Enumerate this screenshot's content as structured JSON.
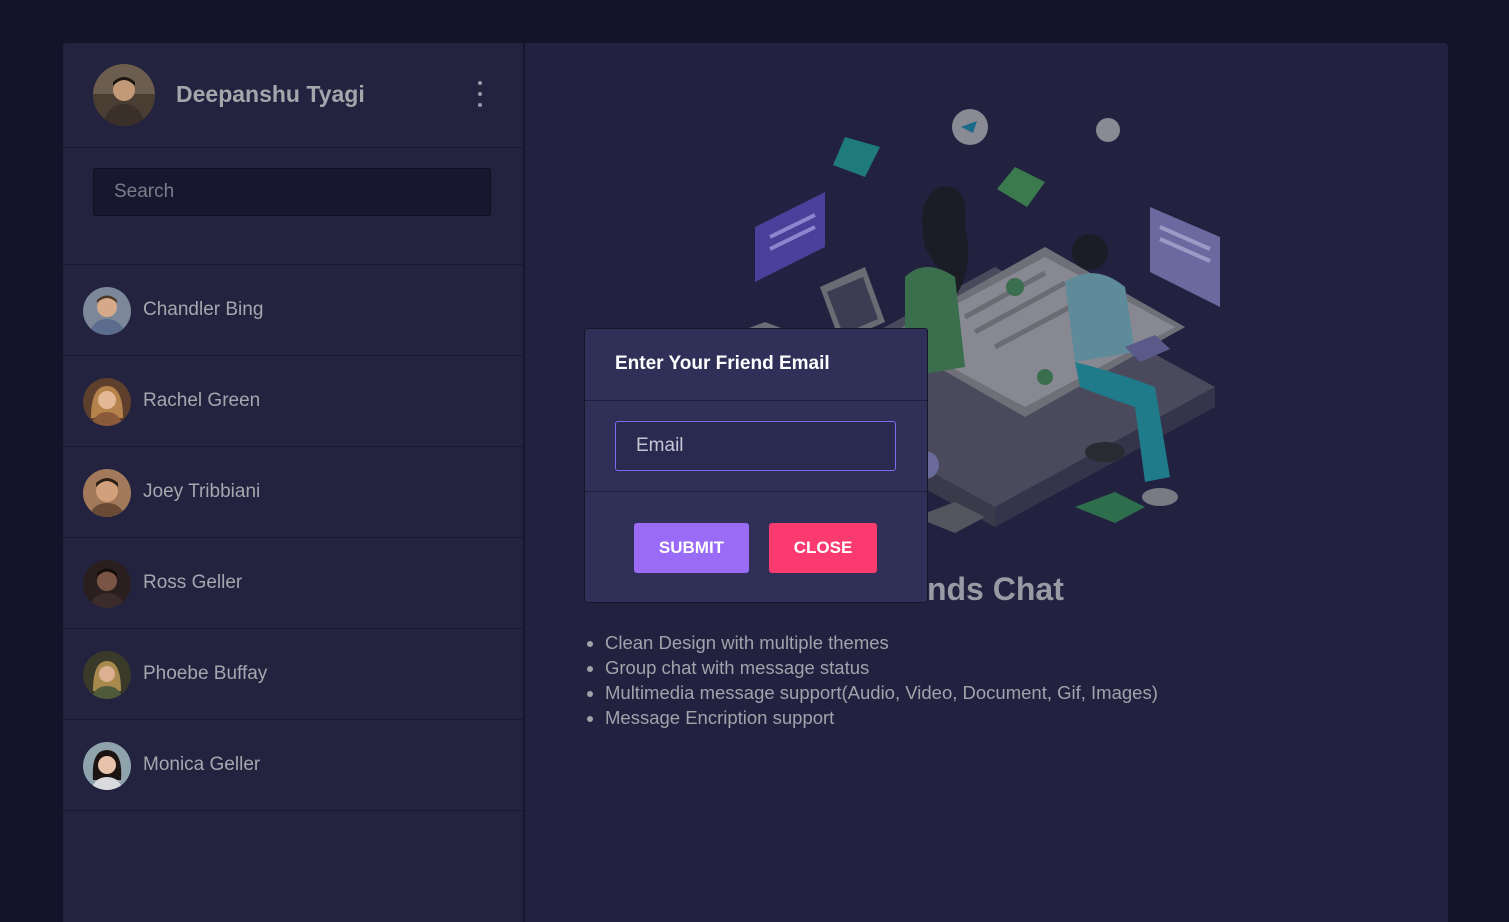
{
  "profile": {
    "name": "Deepanshu Tyagi",
    "menu_icon": "kebab-menu-icon"
  },
  "search": {
    "placeholder": "Search",
    "value": ""
  },
  "contacts": [
    {
      "name": "Chandler Bing"
    },
    {
      "name": "Rachel Green"
    },
    {
      "name": "Joey Tribbiani"
    },
    {
      "name": "Ross Geller"
    },
    {
      "name": "Phoebe Buffay"
    },
    {
      "name": "Monica Geller"
    }
  ],
  "welcome": {
    "title": "ends Chat",
    "features": [
      "Clean Design with multiple themes",
      "Group chat with message status",
      "Multimedia message support(Audio, Video, Document, Gif, Images)",
      "Message Encription support"
    ]
  },
  "modal": {
    "title": "Enter Your Friend Email",
    "email_placeholder": "Email",
    "email_value": "",
    "submit_label": "SUBMIT",
    "close_label": "CLOSE"
  },
  "colors": {
    "page_bg": "#13132a",
    "panel_bg": "#232340",
    "modal_bg": "#302f58",
    "submit": "#9a6bf6",
    "close": "#fb3a6f",
    "input_focus_border": "#7d6cf0"
  }
}
